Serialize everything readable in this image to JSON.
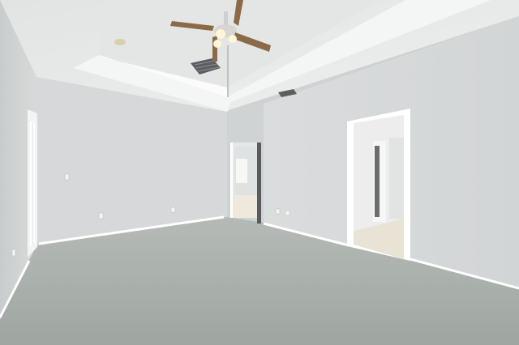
{
  "scene": {
    "kind": "photo",
    "subject": "empty-room-interior",
    "colors": {
      "ceiling": "#e9ebeb",
      "ceiling_tray": "#f1f2f2",
      "wall_left": "#d4d6d6",
      "wall_back": "#dcdedf",
      "wall_right": "#d9dbdc",
      "carpet": "#a9afab",
      "trim": "#ffffff",
      "doorway_light": "#ecebe6",
      "floor_tile": "#e6e0d2",
      "fan_blade": "#8a6a48",
      "vent": "#55595b"
    }
  }
}
